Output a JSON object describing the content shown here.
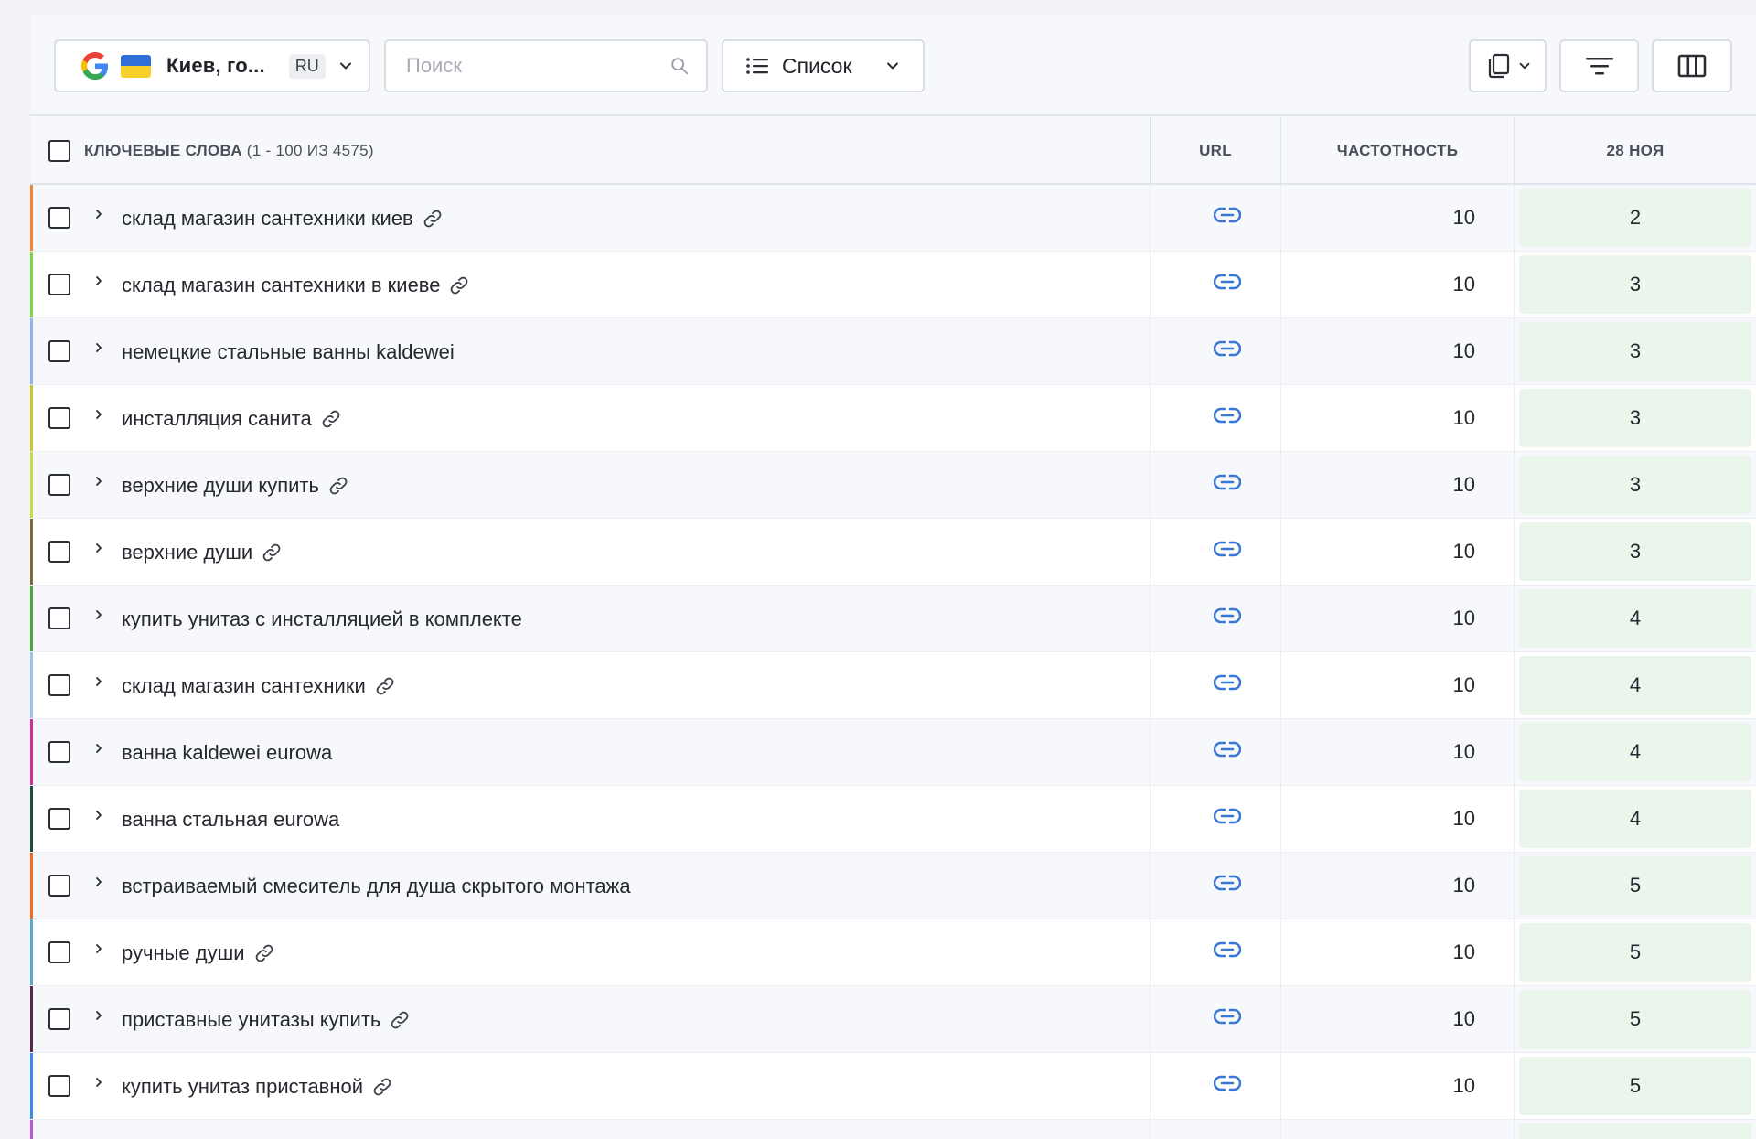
{
  "toolbar": {
    "region_label": "Киев, го...",
    "lang": "RU",
    "search_placeholder": "Поиск",
    "view_label": "Список"
  },
  "table": {
    "header": {
      "keywords": "КЛЮЧЕВЫЕ СЛОВА",
      "keywords_range": "(1 - 100 ИЗ 4575)",
      "url": "URL",
      "frequency": "ЧАСТОТНОСТЬ",
      "date": "28 НОЯ"
    },
    "rows": [
      {
        "keyword": "склад магазин сантехники киев",
        "has_link": true,
        "frequency": "10",
        "position": "2",
        "stripe": "#f0863a"
      },
      {
        "keyword": "склад магазин сантехники в киеве",
        "has_link": true,
        "frequency": "10",
        "position": "3",
        "stripe": "#7fd34a"
      },
      {
        "keyword": "немецкие стальные ванны kaldewei",
        "has_link": false,
        "frequency": "10",
        "position": "3",
        "stripe": "#8fb3ef"
      },
      {
        "keyword": "инсталляция санита",
        "has_link": true,
        "frequency": "10",
        "position": "3",
        "stripe": "#c9c72e"
      },
      {
        "keyword": "верхние души купить",
        "has_link": true,
        "frequency": "10",
        "position": "3",
        "stripe": "#c4dc4a"
      },
      {
        "keyword": "верхние души",
        "has_link": true,
        "frequency": "10",
        "position": "3",
        "stripe": "#7a6a3a"
      },
      {
        "keyword": "купить унитаз с инсталляцией в комплекте",
        "has_link": false,
        "frequency": "10",
        "position": "4",
        "stripe": "#4aa53a"
      },
      {
        "keyword": "склад магазин сантехники",
        "has_link": true,
        "frequency": "10",
        "position": "4",
        "stripe": "#9cc4ec"
      },
      {
        "keyword": "ванна kaldewei eurowa",
        "has_link": false,
        "frequency": "10",
        "position": "4",
        "stripe": "#d0309a"
      },
      {
        "keyword": "ванна стальная eurowa",
        "has_link": false,
        "frequency": "10",
        "position": "4",
        "stripe": "#1f4d3a"
      },
      {
        "keyword": "встраиваемый смеситель для душа скрытого монтажа",
        "has_link": false,
        "frequency": "10",
        "position": "5",
        "stripe": "#f26a2a"
      },
      {
        "keyword": "ручные души",
        "has_link": true,
        "frequency": "10",
        "position": "5",
        "stripe": "#5aa9c9"
      },
      {
        "keyword": "приставные унитазы купить",
        "has_link": true,
        "frequency": "10",
        "position": "5",
        "stripe": "#5a2a4a"
      },
      {
        "keyword": "купить унитаз приставной",
        "has_link": true,
        "frequency": "10",
        "position": "5",
        "stripe": "#3d8ee0"
      },
      {
        "keyword": "",
        "has_link": false,
        "frequency": "",
        "position": "",
        "stripe": "#b45ad8"
      }
    ]
  },
  "colors": {
    "accent_link": "#3a78d6",
    "position_bg": "#eaf6ec"
  }
}
